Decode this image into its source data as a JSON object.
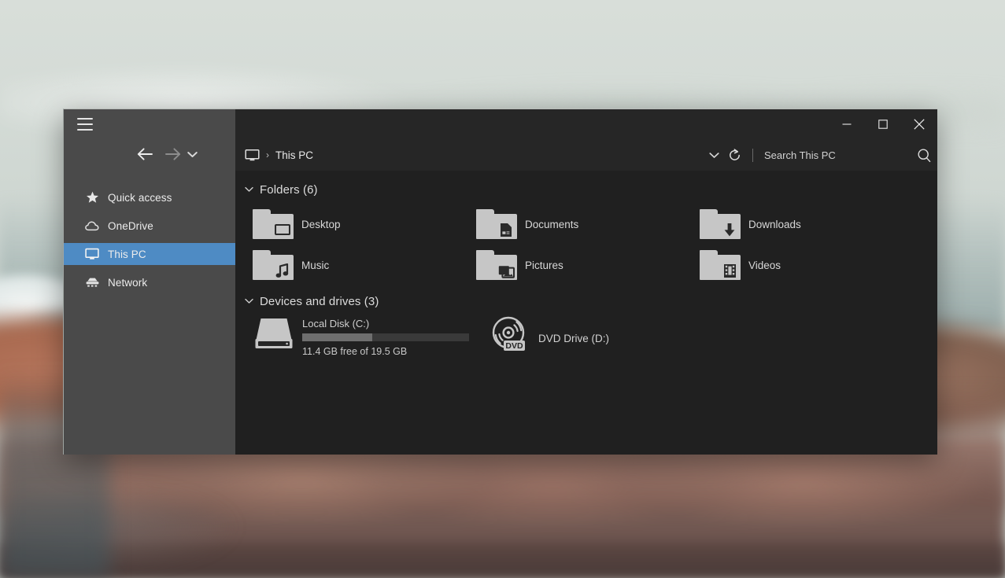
{
  "window": {
    "titlebar_buttons": [
      {
        "name": "minimize",
        "glyph": "minimize-icon"
      },
      {
        "name": "maximize",
        "glyph": "maximize-icon"
      },
      {
        "name": "close",
        "glyph": "close-icon"
      }
    ]
  },
  "nav": {
    "menu_button": "hamburger-menu-icon",
    "back": "back-arrow-icon",
    "forward": "forward-arrow-icon",
    "recent": "recent-locations-chevron-icon",
    "items": [
      {
        "label": "Quick access",
        "icon": "star-icon",
        "selected": false
      },
      {
        "label": "OneDrive",
        "icon": "cloud-icon",
        "selected": false
      },
      {
        "label": "This PC",
        "icon": "monitor-icon",
        "selected": true
      },
      {
        "label": "Network",
        "icon": "network-icon",
        "selected": false
      }
    ]
  },
  "address": {
    "root_icon": "this-pc-monitor-icon",
    "separator": "›",
    "crumb": "This PC",
    "dropdown_icon": "chevron-down-icon",
    "refresh_icon": "refresh-icon",
    "search_placeholder": "Search This PC",
    "search_value": "",
    "search_icon": "search-magnifier-icon"
  },
  "sections": [
    {
      "id": "folders",
      "title": "Folders (6)",
      "expanded": true,
      "items": [
        {
          "label": "Desktop",
          "icon": "folder-desktop-icon"
        },
        {
          "label": "Documents",
          "icon": "folder-documents-icon"
        },
        {
          "label": "Downloads",
          "icon": "folder-downloads-icon"
        },
        {
          "label": "Music",
          "icon": "folder-music-icon"
        },
        {
          "label": "Pictures",
          "icon": "folder-pictures-icon"
        },
        {
          "label": "Videos",
          "icon": "folder-videos-icon"
        }
      ]
    },
    {
      "id": "devices",
      "title": "Devices and drives (3)",
      "expanded": true,
      "drives": [
        {
          "name": "Local Disk (C:)",
          "icon": "hard-disk-icon",
          "free_text": "11.4 GB free of 19.5 GB",
          "used_percent": 42
        },
        {
          "name": "DVD Drive (D:)",
          "icon": "dvd-drive-icon",
          "badge_text": "DVD"
        }
      ]
    }
  ],
  "colors": {
    "accent_selection": "#4e8bc4",
    "nav_pane_bg": "#4a4a4a",
    "content_bg": "#202020",
    "titlebar_bg": "#262626",
    "icon_gray": "#c6c6c6",
    "bar_fill": "#6e6e6e",
    "bar_track": "#3a3a3a"
  }
}
